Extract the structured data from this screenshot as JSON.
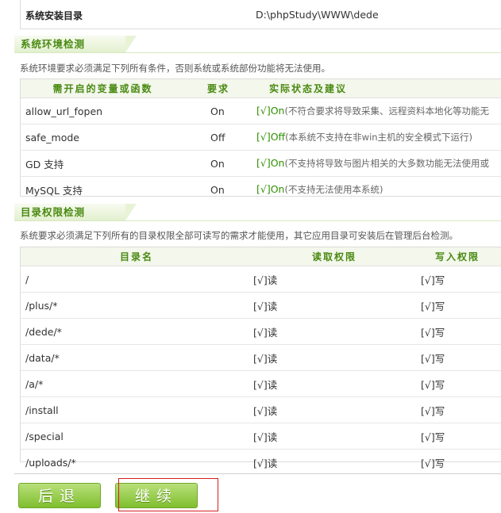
{
  "install_dir": {
    "label": "系统安装目录",
    "value": "D:\\phpStudy\\WWW\\dede"
  },
  "env_check": {
    "title": "系统环境检测",
    "description": "系统环境要求必须满足下列所有条件，否则系统或系统部份功能将无法使用。",
    "headers": [
      "需开启的变量或函数",
      "要求",
      "实际状态及建议"
    ],
    "rows": [
      {
        "name": "allow_url_fopen",
        "req": "On",
        "status": "[√]On",
        "note": "(不符合要求将导致采集、远程资料本地化等功能无"
      },
      {
        "name": "safe_mode",
        "req": "Off",
        "status": "[√]Off",
        "note": "(本系统不支持在非win主机的安全模式下运行)"
      },
      {
        "name": "GD 支持",
        "req": "On",
        "status": "[√]On",
        "note": "(不支持将导致与图片相关的大多数功能无法使用或"
      },
      {
        "name": "MySQL 支持",
        "req": "On",
        "status": "[√]On",
        "note": "(不支持无法使用本系统)"
      }
    ]
  },
  "dir_check": {
    "title": "目录权限检测",
    "description": "系统要求必须满足下列所有的目录权限全部可读写的需求才能使用，其它应用目录可安装后在管理后台检测。",
    "headers": [
      "目录名",
      "读取权限",
      "写入权限"
    ],
    "rows": [
      {
        "dir": "/",
        "read": "[√]读",
        "write": "[√]写"
      },
      {
        "dir": "/plus/*",
        "read": "[√]读",
        "write": "[√]写"
      },
      {
        "dir": "/dede/*",
        "read": "[√]读",
        "write": "[√]写"
      },
      {
        "dir": "/data/*",
        "read": "[√]读",
        "write": "[√]写"
      },
      {
        "dir": "/a/*",
        "read": "[√]读",
        "write": "[√]写"
      },
      {
        "dir": "/install",
        "read": "[√]读",
        "write": "[√]写"
      },
      {
        "dir": "/special",
        "read": "[√]读",
        "write": "[√]写"
      },
      {
        "dir": "/uploads/*",
        "read": "[√]读",
        "write": "[√]写"
      }
    ]
  },
  "buttons": {
    "back": "后退",
    "continue": "继续"
  },
  "colors": {
    "accent_green": "#4a8a12",
    "ok_green": "#2f8f00",
    "highlight_red": "#d61f1f"
  }
}
